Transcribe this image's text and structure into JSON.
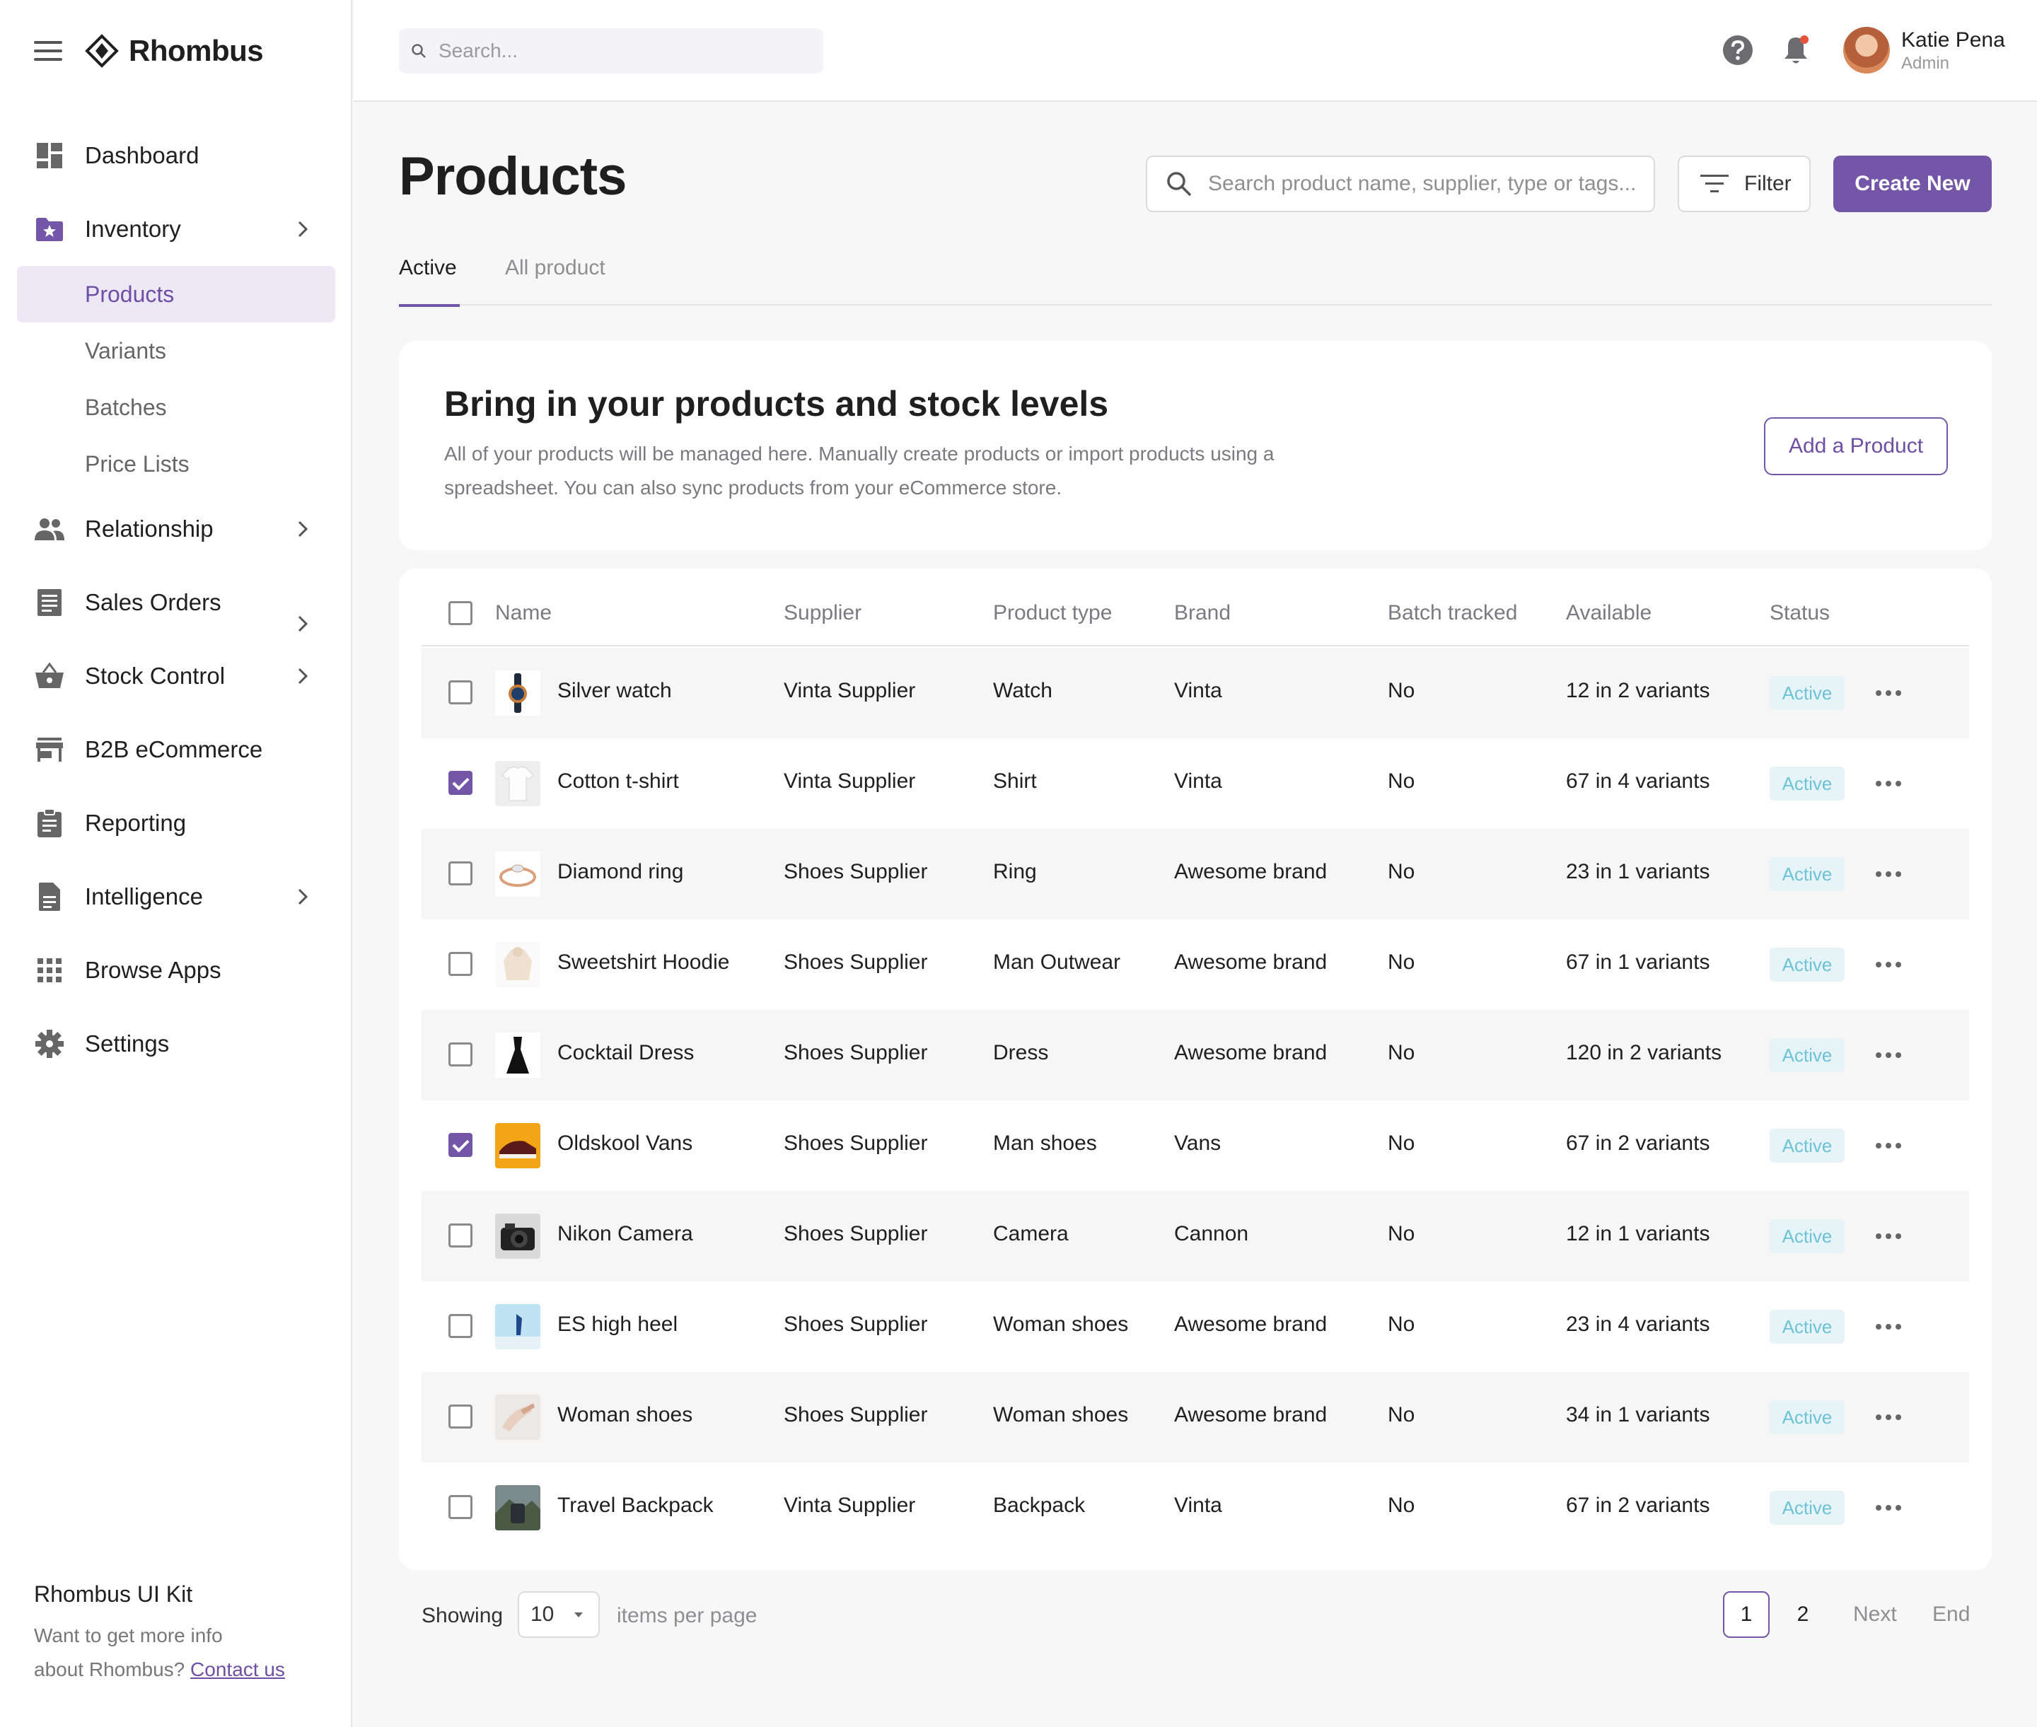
{
  "brand": {
    "name": "Rhombus"
  },
  "sidebar": {
    "items": [
      {
        "label": "Dashboard",
        "icon": "dashboard-icon"
      },
      {
        "label": "Inventory",
        "icon": "inventory-folder-icon"
      },
      {
        "label": "Relationship",
        "icon": "people-icon"
      },
      {
        "label": "Sales Orders",
        "icon": "receipt-icon"
      },
      {
        "label": "Stock Control",
        "icon": "basket-icon"
      },
      {
        "label": "B2B eCommerce",
        "icon": "store-icon"
      },
      {
        "label": "Reporting",
        "icon": "clipboard-icon"
      },
      {
        "label": "Intelligence",
        "icon": "document-icon"
      },
      {
        "label": "Browse Apps",
        "icon": "apps-grid-icon"
      },
      {
        "label": "Settings",
        "icon": "gear-icon"
      }
    ],
    "inventory_sub": [
      "Products",
      "Variants",
      "Batches",
      "Price Lists"
    ],
    "kit": {
      "title": "Rhombus UI Kit",
      "text_line1": "Want to get more info",
      "text_line2": "about Rhombus?",
      "link": "Contact us"
    }
  },
  "topbar": {
    "search_placeholder": "Search...",
    "user": {
      "name": "Katie Pena",
      "role": "Admin"
    }
  },
  "page": {
    "title": "Products",
    "search_placeholder": "Search product name, supplier, type or tags...",
    "filter_label": "Filter",
    "create_label": "Create New",
    "tabs": [
      "Active",
      "All product"
    ]
  },
  "banner": {
    "title": "Bring in your products and stock levels",
    "text": "All of your products will be managed here. Manually create products or import products using a spreadsheet. You can also sync products from your eCommerce store.",
    "button": "Add a Product"
  },
  "table": {
    "headers": [
      "Name",
      "Supplier",
      "Product type",
      "Brand",
      "Batch tracked",
      "Available",
      "Status"
    ],
    "rows": [
      {
        "name": "Silver watch",
        "supplier": "Vinta Supplier",
        "type": "Watch",
        "brand": "Vinta",
        "batch": "No",
        "available": "12 in 2 variants",
        "status": "Active",
        "checked": false
      },
      {
        "name": "Cotton t-shirt",
        "supplier": "Vinta Supplier",
        "type": "Shirt",
        "brand": "Vinta",
        "batch": "No",
        "available": "67 in 4 variants",
        "status": "Active",
        "checked": true
      },
      {
        "name": "Diamond ring",
        "supplier": "Shoes Supplier",
        "type": "Ring",
        "brand": "Awesome brand",
        "batch": "No",
        "available": "23 in 1 variants",
        "status": "Active",
        "checked": false
      },
      {
        "name": "Sweetshirt Hoodie",
        "supplier": "Shoes Supplier",
        "type": "Man Outwear",
        "brand": "Awesome brand",
        "batch": "No",
        "available": "67 in 1 variants",
        "status": "Active",
        "checked": false
      },
      {
        "name": "Cocktail Dress",
        "supplier": "Shoes Supplier",
        "type": "Dress",
        "brand": "Awesome brand",
        "batch": "No",
        "available": "120 in 2 variants",
        "status": "Active",
        "checked": false
      },
      {
        "name": "Oldskool Vans",
        "supplier": "Shoes Supplier",
        "type": "Man shoes",
        "brand": "Vans",
        "batch": "No",
        "available": "67 in 2 variants",
        "status": "Active",
        "checked": true
      },
      {
        "name": "Nikon Camera",
        "supplier": "Shoes Supplier",
        "type": "Camera",
        "brand": "Cannon",
        "batch": "No",
        "available": "12 in 1 variants",
        "status": "Active",
        "checked": false
      },
      {
        "name": "ES high heel",
        "supplier": "Shoes Supplier",
        "type": "Woman shoes",
        "brand": "Awesome brand",
        "batch": "No",
        "available": "23 in 4 variants",
        "status": "Active",
        "checked": false
      },
      {
        "name": "Woman shoes",
        "supplier": "Shoes Supplier",
        "type": "Woman shoes",
        "brand": "Awesome brand",
        "batch": "No",
        "available": "34 in 1 variants",
        "status": "Active",
        "checked": false
      },
      {
        "name": "Travel Backpack",
        "supplier": "Vinta Supplier",
        "type": "Backpack",
        "brand": "Vinta",
        "batch": "No",
        "available": "67 in 2 variants",
        "status": "Active",
        "checked": false
      }
    ]
  },
  "pagination": {
    "showing": "Showing",
    "per_page": "10",
    "items_per_page": "items per page",
    "pages": [
      "1",
      "2"
    ],
    "next": "Next",
    "end": "End"
  },
  "colors": {
    "accent": "#7356a8",
    "status_bg": "#e7f4f7",
    "status_text": "#6cc2d6"
  }
}
